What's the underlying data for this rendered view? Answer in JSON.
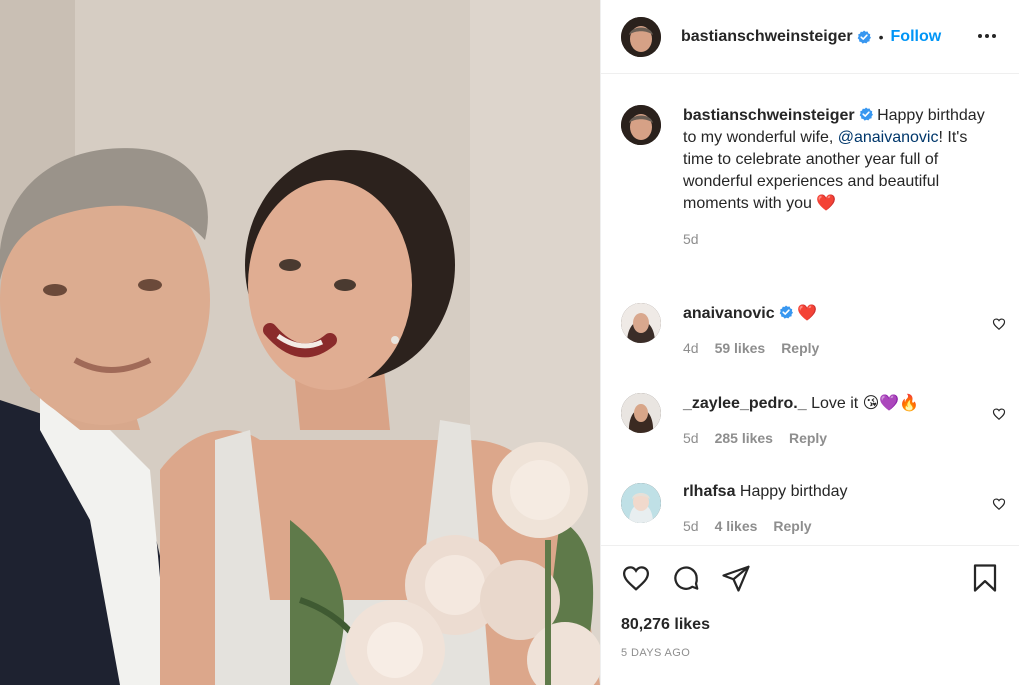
{
  "photo": {
    "alt": "Post photo"
  },
  "header": {
    "username": "bastianschweinsteiger",
    "separator": "•",
    "follow_label": "Follow"
  },
  "caption": {
    "username": "bastianschweinsteiger",
    "text_before_mention": "Happy birthday to my wonderful wife,",
    "mention": "@anaivanovic",
    "text_after_mention": "! It's time to celebrate another year full of wonderful experiences and beautiful moments with you",
    "emoji": "❤️",
    "time": "5d"
  },
  "comments": [
    {
      "username": "anaivanovic",
      "verified": true,
      "text": "",
      "emoji": "❤️",
      "time": "4d",
      "likes": "59 likes",
      "reply": "Reply"
    },
    {
      "username": "_zaylee_pedro._",
      "verified": false,
      "text": "Love it",
      "emoji": "😘💜🔥",
      "time": "5d",
      "likes": "285 likes",
      "reply": "Reply"
    },
    {
      "username": "rlhafsa",
      "verified": false,
      "text": "Happy birthday",
      "emoji": "",
      "time": "5d",
      "likes": "4 likes",
      "reply": "Reply"
    }
  ],
  "footer": {
    "likes": "80,276 likes",
    "posted": "5 DAYS AGO"
  },
  "icons": {
    "verified": "verified-badge-icon",
    "more": "more-options-icon",
    "like": "heart-icon",
    "comment": "comment-icon",
    "share": "share-icon",
    "save": "bookmark-icon"
  },
  "colors": {
    "accent": "#0095f6",
    "verified": "#3897f0",
    "heart": "#ed4956",
    "secondary_text": "#8e8e8e",
    "border": "#efefef"
  }
}
